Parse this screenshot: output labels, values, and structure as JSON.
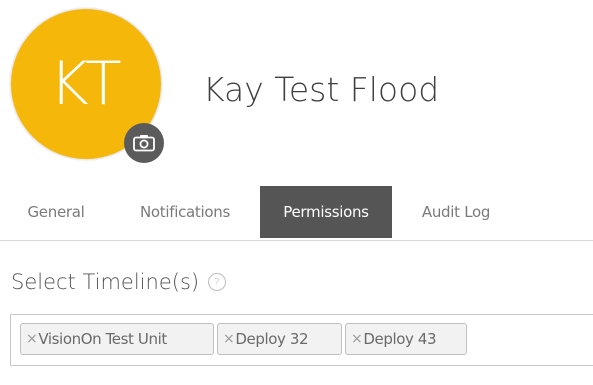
{
  "profile": {
    "initials": "KT",
    "name": "Kay Test Flood",
    "avatar_color": "#F5B70A",
    "camera_icon": "camera-icon"
  },
  "tabs": [
    {
      "label": "General",
      "active": false
    },
    {
      "label": "Notifications",
      "active": false
    },
    {
      "label": "Permissions",
      "active": true
    },
    {
      "label": "Audit Log",
      "active": false
    }
  ],
  "permissions": {
    "timeline_label": "Select Timeline(s)",
    "help_icon": "question-circle-icon",
    "selected_timelines": [
      {
        "remove": "×",
        "label": "VisionOn Test Unit"
      },
      {
        "remove": "×",
        "label": "Deploy 32"
      },
      {
        "remove": "×",
        "label": "Deploy 43"
      }
    ]
  },
  "colors": {
    "active_tab_bg": "#555555",
    "chip_bg": "#F2F2F2"
  }
}
